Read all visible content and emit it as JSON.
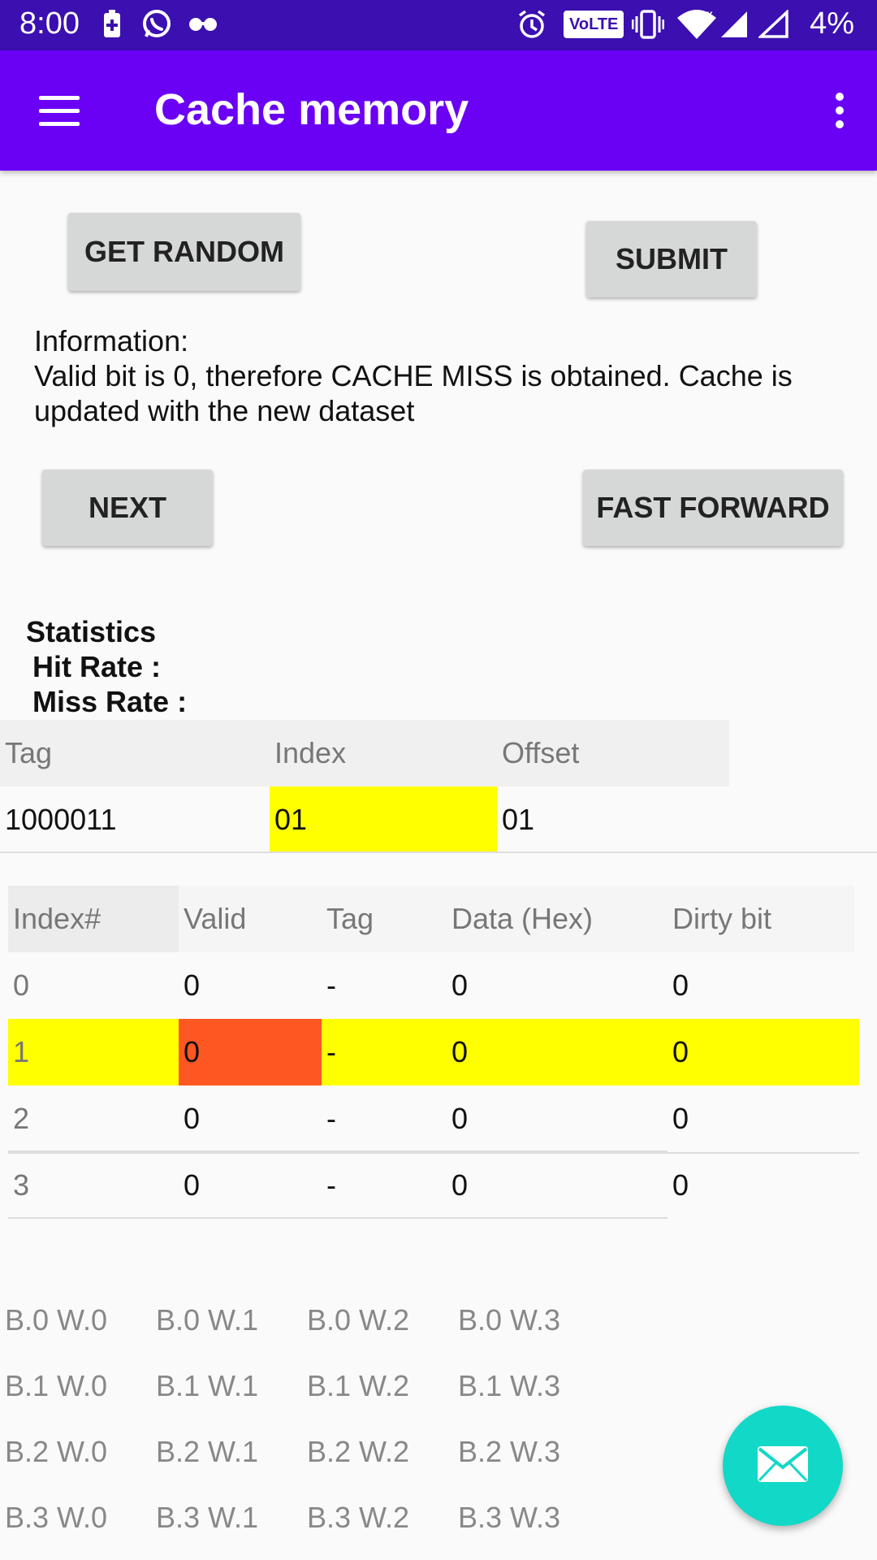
{
  "status_bar": {
    "time": "8:00",
    "battery_percent": "4%",
    "icons": [
      "battery-saver-icon",
      "whatsapp-icon",
      "glasses-icon",
      "alarm-icon",
      "volte-icon",
      "vibrate-icon",
      "wifi-icon",
      "signal-icon",
      "signal-empty-icon"
    ],
    "volte_label": "VoLTE"
  },
  "app_bar": {
    "title": "Cache memory",
    "background": "#6a00f4"
  },
  "buttons": {
    "get_random": "GET RANDOM",
    "submit": "SUBMIT",
    "next": "NEXT",
    "fast_forward": "FAST FORWARD"
  },
  "information": {
    "heading": "Information:",
    "text": "Valid bit is 0, therefore CACHE MISS is obtained. Cache is updated with the new dataset"
  },
  "statistics": {
    "heading": "Statistics",
    "hit_rate_label": "Hit Rate :",
    "miss_rate_label": "Miss Rate :"
  },
  "address": {
    "headers": [
      "Tag",
      "Index",
      "Offset"
    ],
    "values": [
      "1000011",
      "01",
      "01"
    ],
    "highlight_color": "#ffff00"
  },
  "cache_table": {
    "headers": [
      "Index#",
      "Valid",
      "Tag",
      "Data (Hex)",
      "Dirty bit"
    ],
    "rows": [
      [
        "0",
        "0",
        "-",
        "0",
        "0"
      ],
      [
        "1",
        "0",
        "-",
        "0",
        "0"
      ],
      [
        "2",
        "0",
        "-",
        "0",
        "0"
      ],
      [
        "3",
        "0",
        "-",
        "0",
        "0"
      ]
    ],
    "highlight_row": 1,
    "highlight_color": "#ffff00",
    "valid_highlight_color": "#ff5722"
  },
  "block_words": [
    [
      "B.0 W.0",
      "B.0 W.1",
      "B.0 W.2",
      "B.0 W.3"
    ],
    [
      "B.1 W.0",
      "B.1 W.1",
      "B.1 W.2",
      "B.1 W.3"
    ],
    [
      "B.2 W.0",
      "B.2 W.1",
      "B.2 W.2",
      "B.2 W.3"
    ],
    [
      "B.3 W.0",
      "B.3 W.1",
      "B.3 W.2",
      "B.3 W.3"
    ]
  ],
  "fab": {
    "icon": "email-icon",
    "color": "#12d8c7"
  }
}
